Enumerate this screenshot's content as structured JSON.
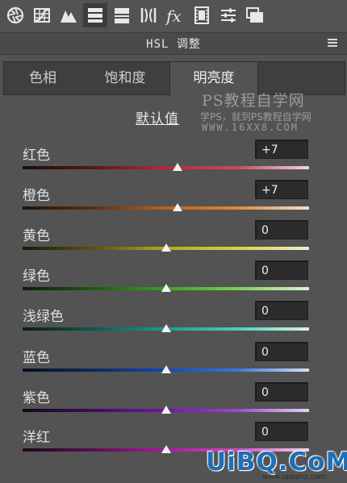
{
  "toolbar": {
    "icons": [
      {
        "name": "basic-aperture-icon",
        "active": false
      },
      {
        "name": "tone-curve-icon",
        "active": false
      },
      {
        "name": "detail-icon",
        "active": false
      },
      {
        "name": "hsl-icon",
        "active": true
      },
      {
        "name": "split-toning-icon",
        "active": false
      },
      {
        "name": "lens-corrections-icon",
        "active": false
      },
      {
        "name": "effects-fx-icon",
        "active": false
      },
      {
        "name": "camera-calibration-icon",
        "active": false
      },
      {
        "name": "presets-icon",
        "active": false
      },
      {
        "name": "snapshots-icon",
        "active": false
      }
    ]
  },
  "panel": {
    "title": "HSL 调整"
  },
  "tabs": [
    {
      "label": "色相",
      "active": false
    },
    {
      "label": "饱和度",
      "active": false
    },
    {
      "label": "明亮度",
      "active": true
    }
  ],
  "default_link": "默认值",
  "watermark": {
    "title": "PS教程自学网",
    "subtitle": "学PS，就到PS教程自学网",
    "url": "WWW.16XX8.COM"
  },
  "rows": [
    {
      "label": "红色",
      "value": "+7",
      "level": 0.54,
      "colors": [
        "#1e0b0b",
        "#5a1818",
        "#b8283a",
        "#c84a62",
        "#efd6da"
      ]
    },
    {
      "label": "橙色",
      "value": "+7",
      "level": 0.54,
      "colors": [
        "#1e1208",
        "#5e3012",
        "#b8621e",
        "#d88a3a",
        "#efe0d2"
      ]
    },
    {
      "label": "黄色",
      "value": "0",
      "level": 0.5,
      "colors": [
        "#1c1a08",
        "#5a5212",
        "#b5a81e",
        "#d8d046",
        "#f0eed4"
      ]
    },
    {
      "label": "绿色",
      "value": "0",
      "level": 0.5,
      "colors": [
        "#0c1c08",
        "#1e5a12",
        "#3ea022",
        "#7ad050",
        "#e2f2da"
      ]
    },
    {
      "label": "浅绿色",
      "value": "0",
      "level": 0.5,
      "colors": [
        "#081c18",
        "#0e5a4e",
        "#14a08a",
        "#4ad0b8",
        "#d8f2ee"
      ]
    },
    {
      "label": "蓝色",
      "value": "0",
      "level": 0.5,
      "colors": [
        "#080e1e",
        "#0e2a5e",
        "#1448b0",
        "#3a76dc",
        "#d4e0f4"
      ]
    },
    {
      "label": "紫色",
      "value": "0",
      "level": 0.5,
      "colors": [
        "#14081c",
        "#3c0e5a",
        "#7414ac",
        "#9c48d0",
        "#e6d6f2"
      ]
    },
    {
      "label": "洋红",
      "value": "0",
      "level": 0.5,
      "colors": [
        "#1c081a",
        "#5a0e52",
        "#b018a0",
        "#d04ac4",
        "#f2d6ee"
      ]
    }
  ],
  "logo": {
    "text": "UiBQ.CoM",
    "sub": "www.upsahz.com"
  }
}
